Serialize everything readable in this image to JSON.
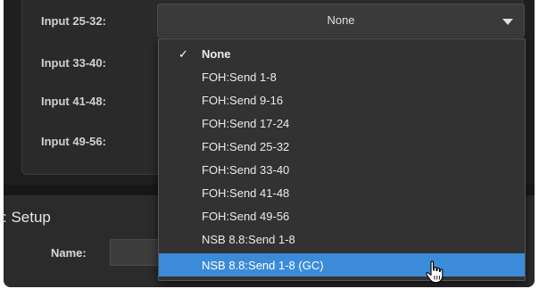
{
  "form": {
    "rows": [
      {
        "label": "Input 25-32:"
      },
      {
        "label": "Input 33-40:"
      },
      {
        "label": "Input 41-48:"
      },
      {
        "label": "Input 49-56:"
      }
    ],
    "select": {
      "value": "None",
      "arrow_icon": "triangle-down-icon"
    }
  },
  "dropdown": {
    "items": [
      {
        "label": "None",
        "checked": true
      },
      {
        "label": "FOH:Send 1-8"
      },
      {
        "label": "FOH:Send 9-16"
      },
      {
        "label": "FOH:Send 17-24"
      },
      {
        "label": "FOH:Send 25-32"
      },
      {
        "label": "FOH:Send 33-40"
      },
      {
        "label": "FOH:Send 41-48"
      },
      {
        "label": "FOH:Send 49-56"
      },
      {
        "label": "NSB 8.8:Send 1-8"
      },
      {
        "label": "NSB 8.8:Send 1-8 (GC)",
        "highlighted": true
      }
    ],
    "check_glyph": "✓",
    "highlight_color": "#3b8bd9"
  },
  "setup": {
    "title": ": Setup",
    "name_label": "Name:",
    "name_value": ""
  },
  "cursor_icon": "hand-pointer-icon"
}
